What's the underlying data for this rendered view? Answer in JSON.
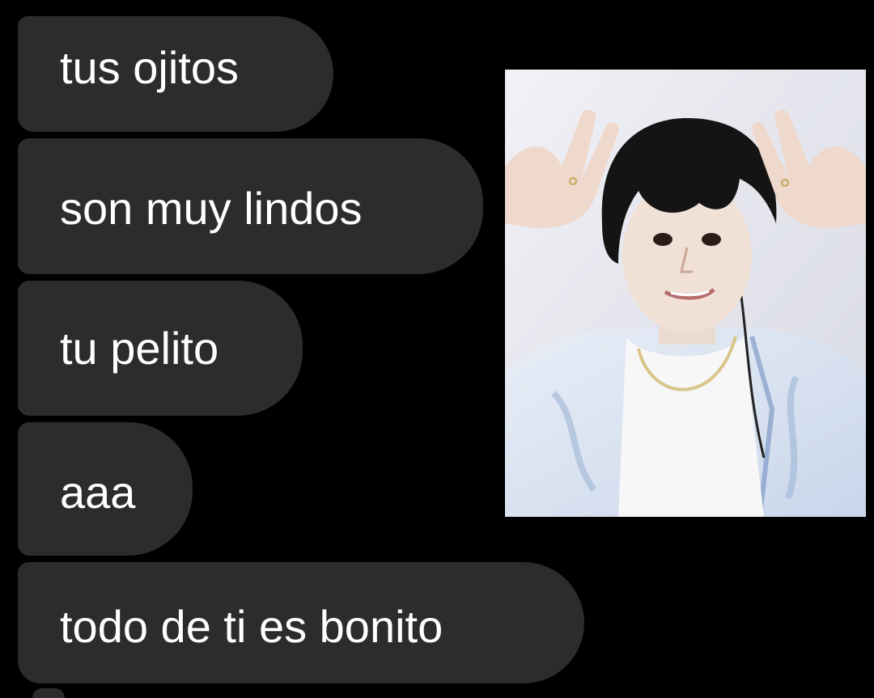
{
  "messages": [
    {
      "text": "tus ojitos"
    },
    {
      "text": "son muy lindos"
    },
    {
      "text": "tu pelito"
    },
    {
      "text": "aaa"
    },
    {
      "text": "todo de ti es bonito"
    }
  ],
  "photo": {
    "icon": "person-selfie-photo"
  },
  "colors": {
    "background": "#000000",
    "bubble": "#2c2c2c",
    "text": "#ffffff"
  }
}
